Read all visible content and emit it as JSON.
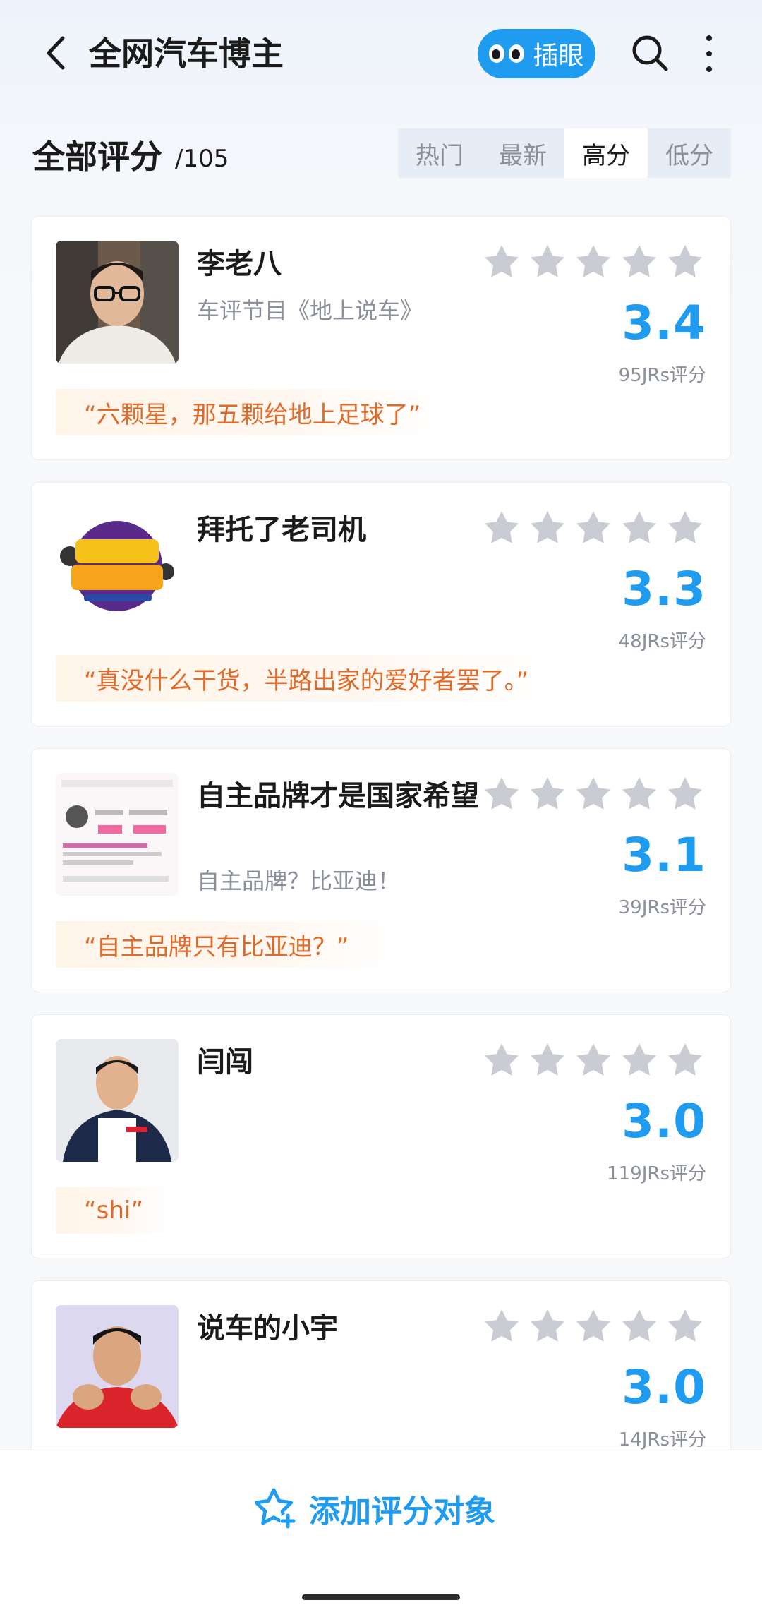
{
  "header": {
    "title": "全网汽车博主",
    "peek_label": "插眼",
    "icons": {
      "back": "chevron-left-icon",
      "search": "search-icon",
      "more": "more-vertical-icon",
      "peek": "eyes-icon"
    }
  },
  "section": {
    "title": "全部评分",
    "count": "/105",
    "sort_tabs": [
      {
        "label": "热门",
        "active": false
      },
      {
        "label": "最新",
        "active": false
      },
      {
        "label": "高分",
        "active": true
      },
      {
        "label": "低分",
        "active": false
      }
    ]
  },
  "items": [
    {
      "name": "李老八",
      "desc": "车评节目《地上说车》",
      "score": "3.4",
      "votes": "95JRs评分",
      "quote": "“六颗星，那五颗给地上足球了”",
      "stars_filled": 0
    },
    {
      "name": "拜托了老司机",
      "desc": "",
      "score": "3.3",
      "votes": "48JRs评分",
      "quote": "“真没什么干货，半路出家的爱好者罢了。”",
      "stars_filled": 0
    },
    {
      "name": "自主品牌才是国家希望",
      "desc": "自主品牌？比亚迪！",
      "score": "3.1",
      "votes": "39JRs评分",
      "quote": "“自主品牌只有比亚迪？”",
      "stars_filled": 0
    },
    {
      "name": "闫闯",
      "desc": "",
      "score": "3.0",
      "votes": "119JRs评分",
      "quote": "“shi”",
      "stars_filled": 0
    },
    {
      "name": "说车的小宇",
      "desc": "",
      "score": "3.0",
      "votes": "14JRs评分",
      "quote": "",
      "stars_filled": 0
    }
  ],
  "bottom": {
    "add_label": "添加评分对象",
    "icon": "star-plus-icon"
  },
  "colors": {
    "accent": "#1f9cf0",
    "quote_text": "#e06a2a",
    "star_empty": "#c9ccd3"
  }
}
